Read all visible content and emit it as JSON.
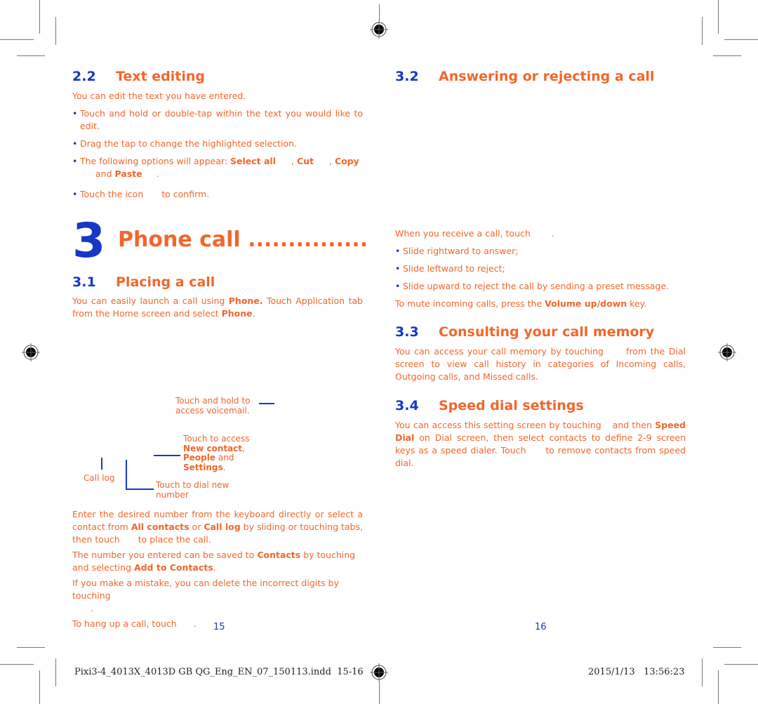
{
  "left_page": {
    "section_2_2": {
      "number": "2.2",
      "title": "Text editing",
      "intro": "You can edit the text you have entered.",
      "bullets": [
        "Touch and hold or double-tap within the text you would like to edit.",
        "Drag the tap to change the highlighted selection."
      ],
      "options_bullet": {
        "prefix": "The following options will appear: ",
        "select_all": "Select all",
        "sep1": ", ",
        "cut": "Cut",
        "sep2": ", ",
        "copy": "Copy",
        "and": "and ",
        "paste": "Paste",
        "end": "."
      },
      "confirm_bullet": {
        "prefix": "Touch the icon",
        "suffix": "to confirm."
      }
    },
    "chapter": {
      "number": "3",
      "title": "Phone call ..............."
    },
    "section_3_1": {
      "number": "3.1",
      "title": "Placing a call",
      "intro_a": "You can easily launch a call using ",
      "intro_phone": "Phone.",
      "intro_b": " Touch Application tab from the Home screen and select ",
      "intro_phone2": "Phone",
      "intro_end": "."
    },
    "callouts": {
      "voicemail": "Touch and hold to access voicemail.",
      "menu_a": "Touch to access",
      "menu_new_contact": "New contact",
      "menu_comma": ",",
      "menu_people": "People",
      "menu_and": " and",
      "menu_settings": "Settings",
      "menu_period": ".",
      "call_log": "Call log",
      "dial_new": "Touch to dial new number"
    },
    "paragraphs": {
      "enter_a": "Enter the desired number from the keyboard directly or select a contact from ",
      "all_contacts": "All contacts",
      "enter_or": " or ",
      "call_log": "Call log",
      "enter_b": " by sliding or touching tabs, then touch",
      "enter_c": "to place the call.",
      "save_a": "The number you entered can be saved to ",
      "contacts": "Contacts",
      "save_b": " by touching and selecting ",
      "add_to_contacts": "Add to Contacts",
      "save_end": ".",
      "mistake": "If you make a mistake, you can delete the incorrect digits by touching",
      "mistake_end": ".",
      "hangup_a": "To hang up a call, touch",
      "hangup_end": "."
    },
    "page_number": "15"
  },
  "right_page": {
    "section_3_2": {
      "number": "3.2",
      "title": "Answering or rejecting a call",
      "intro_a": "When you receive a call, touch",
      "intro_end": ".",
      "bullets": [
        "Slide rightward to answer;",
        "Slide leftward to reject;",
        "Slide upward to reject the call by sending a preset message."
      ],
      "mute_a": "To mute incoming calls, press the ",
      "mute_key": "Volume up/down",
      "mute_b": " key."
    },
    "section_3_3": {
      "number": "3.3",
      "title": "Consulting your call memory",
      "text_a": "You can access your call memory by touching",
      "text_b": "from the Dial screen to view call history in categories of Incoming calls, Outgoing calls, and Missed calls."
    },
    "section_3_4": {
      "number": "3.4",
      "title": "Speed dial settings",
      "text_a": "You can access this setting screen by touching",
      "text_b": "and then ",
      "speed_dial": "Speed Dial",
      "text_c": " on Dial screen, then select contacts to define 2-9 screen keys as a speed dialer. Touch",
      "text_d": "to remove contacts from speed dial."
    },
    "page_number": "16"
  },
  "slug": {
    "filename": "Pixi3-4_4013X_4013D GB QG_Eng_EN_07_150113.indd",
    "pages": "15-16",
    "date": "2015/1/13",
    "time": "13:56:23"
  },
  "colors": {
    "heading": "#f2662b",
    "body": "#f2662b",
    "accent_blue": "#1737c6"
  }
}
